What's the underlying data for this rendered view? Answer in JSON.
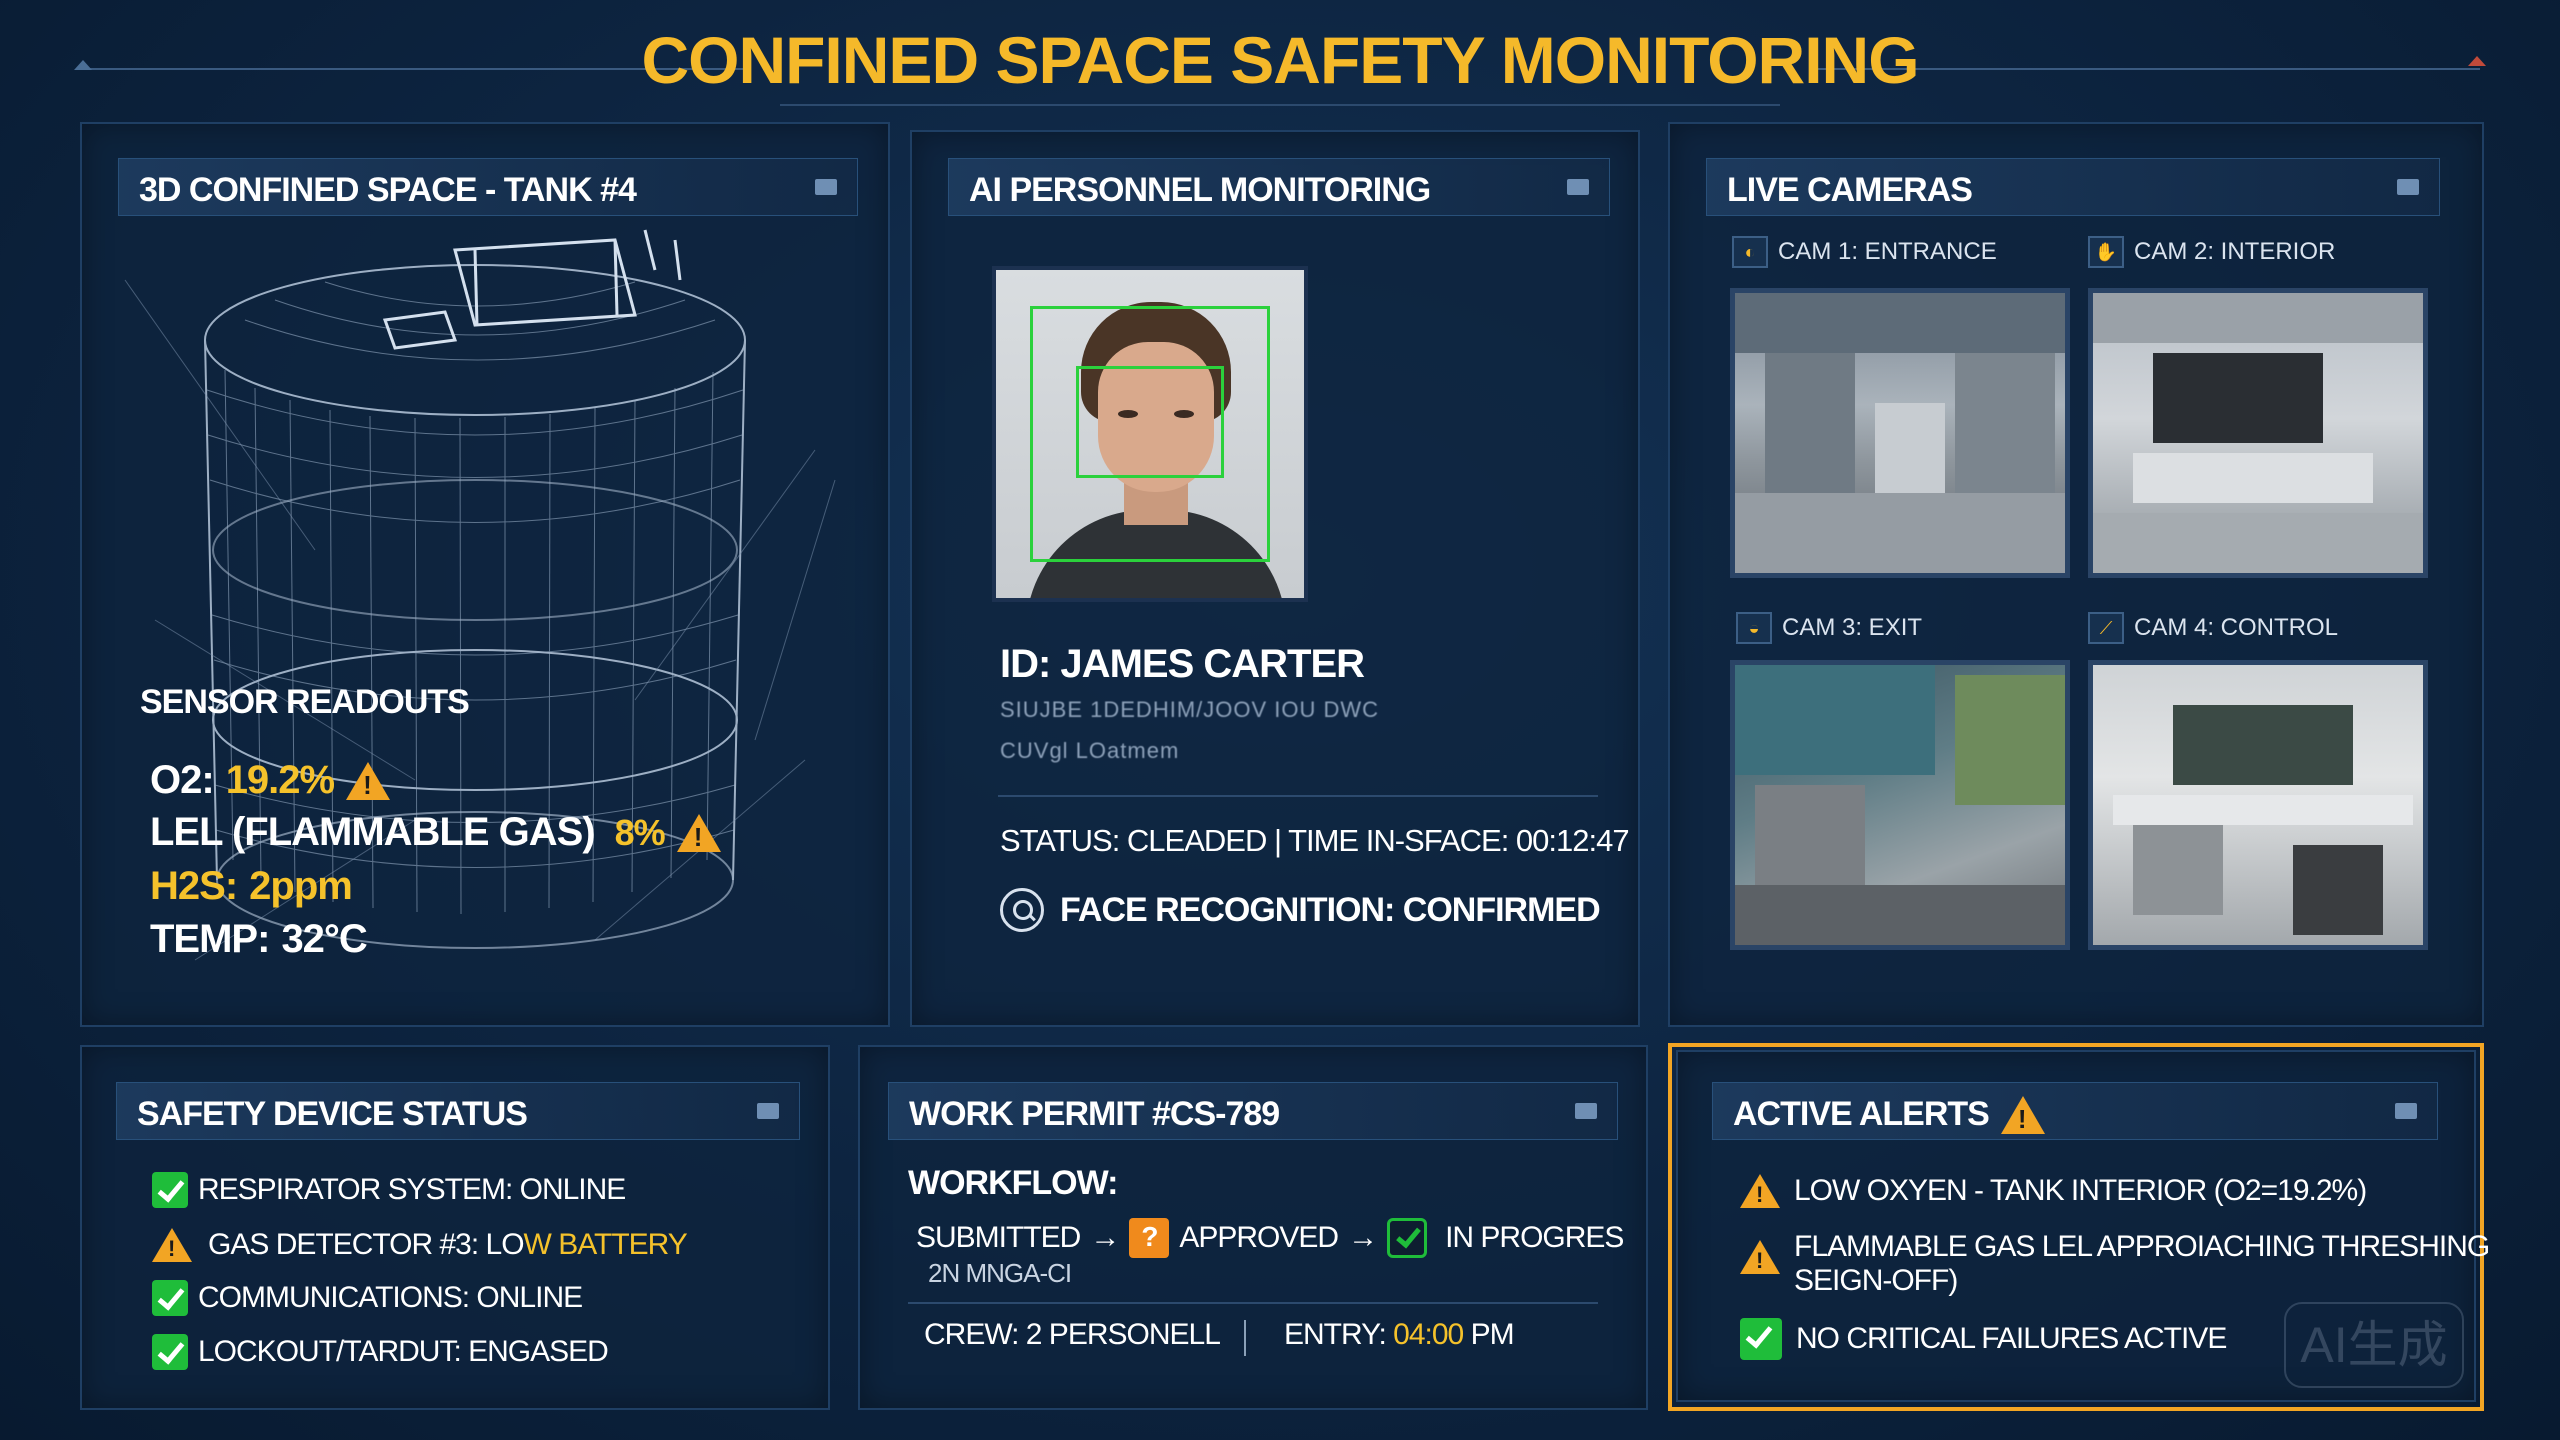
{
  "header": {
    "title": "CONFINED SPACE SAFETY MONITORING"
  },
  "tank_panel": {
    "title": "3D CONFINED SPACE - TANK #4",
    "sensor_title": "SENSOR READOUTS",
    "sensors": [
      {
        "label": "O2:",
        "value": "19.2%",
        "warning": true
      },
      {
        "label": "LEL (FLAMMABLE GAS)",
        "value": "8%",
        "warning": true
      },
      {
        "label": "H2S:",
        "value": "2ppm",
        "warning": false
      },
      {
        "label": "TEMP:",
        "value": "32°C",
        "warning": false
      }
    ]
  },
  "personnel_panel": {
    "title": "AI PERSONNEL MONITORING",
    "id_text": "ID: JAMES CARTER",
    "blurred_line_1": "SIUJBE 1DEDHIM/JOOV IOU DWC",
    "blurred_line_2": "CUVgl LOatmem",
    "status_text": "STATUS: CLEADED | TIME IN-SFACE: 00:12:47",
    "face_recognition": "FACE RECOGNITION:  CONFIRMED"
  },
  "cameras_panel": {
    "title": "LIVE CAMERAS",
    "cameras": [
      {
        "label": "CAM 1: ENTRANCE",
        "icon": "camera-icon"
      },
      {
        "label": "CAM 2: INTERIOR",
        "icon": "hand-icon"
      },
      {
        "label": "CAM 3: EXIT",
        "icon": "helmet-icon"
      },
      {
        "label": "CAM 4: CONTROL",
        "icon": "wrench-icon"
      }
    ]
  },
  "safety_panel": {
    "title": "SAFETY DEVICE STATUS",
    "devices": [
      {
        "label": "RESPIRATOR SYSTEM: ONLINE",
        "status": "ok"
      },
      {
        "label_main": "GAS DETECTOR #3: LO",
        "label_alert": "W BATTERY",
        "status": "warning"
      },
      {
        "label": "COMMUNICATIONS: ONLINE",
        "status": "ok"
      },
      {
        "label": "LOCKOUT/TARDUT: ENGASED",
        "status": "ok"
      }
    ]
  },
  "permit_panel": {
    "title": "WORK PERMIT #CS-789",
    "workflow_label": "WORKFLOW:",
    "step_submitted": "SUBMITTED",
    "arrow": "→",
    "step_approved": "APPROVED",
    "step_progress": "IN PROGRES",
    "workflow_sub": "2N ΜNGA-CI",
    "crew": "CREW: 2 PERSONELL",
    "entry_label": "ENTRY:",
    "entry_time": "04:00",
    "entry_suffix": "PM"
  },
  "alerts_panel": {
    "title": "ACTIVE ALERTS",
    "alerts": [
      {
        "text": "LOW OXYEN - TANK INTERIOR  (O2=19.2%)",
        "level": "warning"
      },
      {
        "text": "FLAMMABLE GAS LEL APPROIACHING THRESHING",
        "text2": "SEIGN-OFF)",
        "level": "warning"
      },
      {
        "text": "NO CRITICAL FAILURES ACTIVE",
        "level": "ok"
      }
    ]
  },
  "watermark": "AI生成",
  "colors": {
    "accent": "#f5b92a",
    "warning": "#f2a524",
    "ok": "#1fbd3a",
    "detect": "#2bd13c",
    "panel_border": "#1f3f64"
  }
}
